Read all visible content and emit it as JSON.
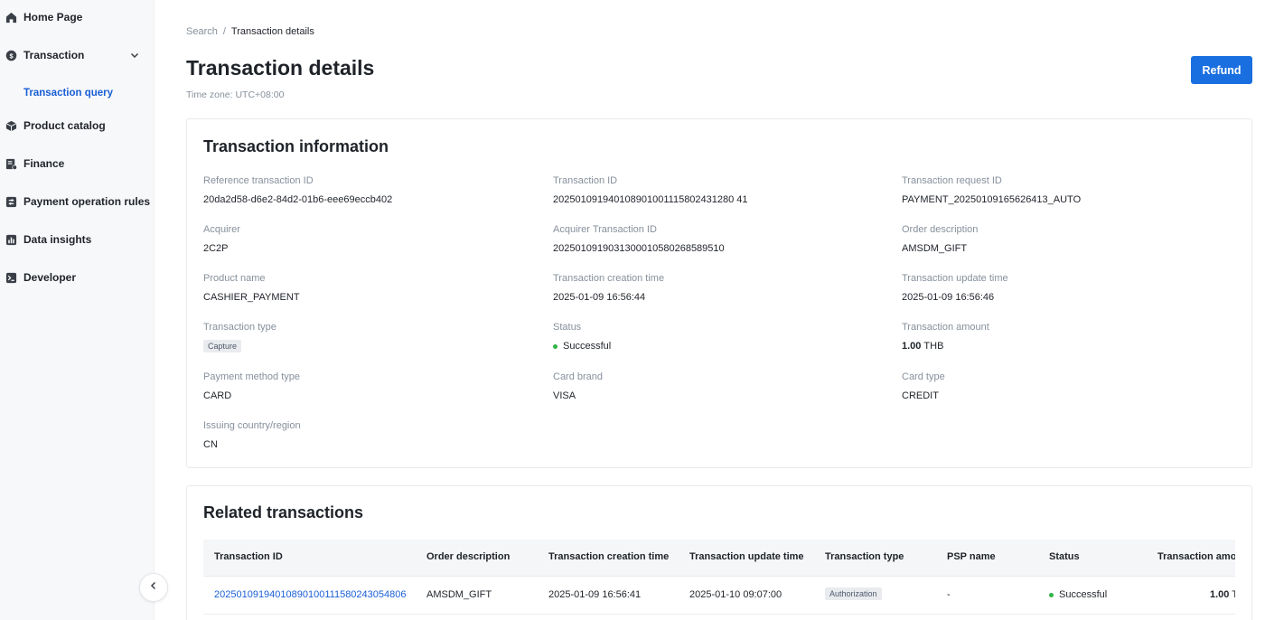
{
  "sidebar": {
    "items": [
      {
        "label": "Home Page",
        "icon": "home-icon"
      },
      {
        "label": "Transaction",
        "icon": "transaction-icon"
      },
      {
        "label": "Product catalog",
        "icon": "box-icon"
      },
      {
        "label": "Finance",
        "icon": "finance-icon"
      },
      {
        "label": "Payment operation rules",
        "icon": "rules-icon"
      },
      {
        "label": "Data insights",
        "icon": "chart-icon"
      },
      {
        "label": "Developer",
        "icon": "terminal-icon"
      }
    ],
    "sub_item": "Transaction query"
  },
  "breadcrumb": {
    "parent": "Search",
    "separator": "/",
    "current": "Transaction details"
  },
  "page": {
    "title": "Transaction details",
    "timezone": "Time zone: UTC+08:00"
  },
  "refund_label": "Refund",
  "info": {
    "title": "Transaction information",
    "fields": [
      {
        "label": "Reference transaction ID",
        "value": "20da2d58-d6e2-84d2-01b6-eee69eccb402"
      },
      {
        "label": "Transaction ID",
        "value": "202501091940108901001115802431280 41"
      },
      {
        "label": "Transaction request ID",
        "value": "PAYMENT_20250109165626413_AUTO"
      },
      {
        "label": "Acquirer",
        "value": "2C2P"
      },
      {
        "label": "Acquirer Transaction ID",
        "value": "2025010919031300010580268589510"
      },
      {
        "label": "Order description",
        "value": "AMSDM_GIFT"
      },
      {
        "label": "Product name",
        "value": "CASHIER_PAYMENT"
      },
      {
        "label": "Transaction creation time",
        "value": "2025-01-09 16:56:44"
      },
      {
        "label": "Transaction update time",
        "value": "2025-01-09 16:56:46"
      },
      {
        "label": "Transaction type",
        "value": "Capture"
      },
      {
        "label": "Status",
        "value": "Successful"
      },
      {
        "label": "Transaction amount",
        "value": "1.00",
        "currency": "THB"
      },
      {
        "label": "Payment method type",
        "value": "CARD"
      },
      {
        "label": "Card brand",
        "value": "VISA"
      },
      {
        "label": "Card type",
        "value": "CREDIT"
      },
      {
        "label": "Issuing country/region",
        "value": "CN"
      }
    ]
  },
  "related": {
    "title": "Related transactions",
    "columns": [
      "Transaction ID",
      "Order description",
      "Transaction creation time",
      "Transaction update time",
      "Transaction type",
      "PSP name",
      "Status",
      "Transaction amo"
    ],
    "rows": [
      {
        "transaction_id": "20250109194010890100111580243054806",
        "order_description": "AMSDM_GIFT",
        "creation_time": "2025-01-09 16:56:41",
        "update_time": "2025-01-10 09:07:00",
        "type": "Authorization",
        "psp_name": "-",
        "status": "Successful",
        "amount": "1.00",
        "amount_suffix": "T"
      }
    ]
  },
  "colors": {
    "accent": "#1a6fe0",
    "link": "#1a5fd6",
    "success": "#2fb344"
  }
}
